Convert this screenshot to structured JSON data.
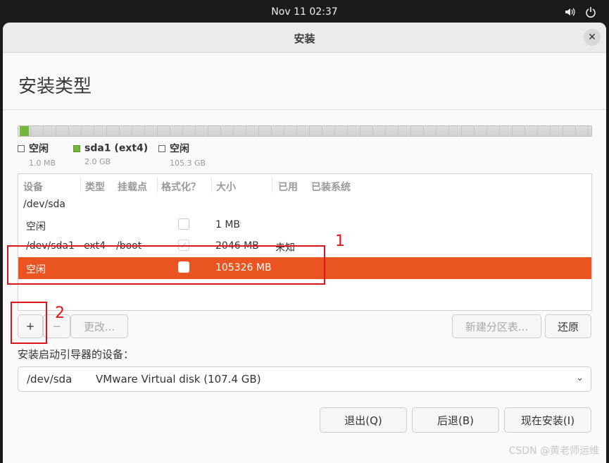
{
  "topbar": {
    "clock": "Nov 11  02:37"
  },
  "window": {
    "title": "安装",
    "close_label": "✕"
  },
  "page": {
    "heading": "安装类型"
  },
  "legend": [
    {
      "name": "空闲",
      "size": "1.0 MB"
    },
    {
      "name": "sda1 (ext4)",
      "size": "2.0 GB"
    },
    {
      "name": "空闲",
      "size": "105.3 GB"
    }
  ],
  "table": {
    "headers": [
      "设备",
      "类型",
      "挂载点",
      "格式化？",
      "大小",
      "已用",
      "已装系统"
    ],
    "rows": [
      {
        "device": "/dev/sda",
        "type": "",
        "mount": "",
        "format": null,
        "size": "",
        "used": ""
      },
      {
        "device": "空闲",
        "type": "",
        "mount": "",
        "format": "unchecked",
        "size": "1 MB",
        "used": ""
      },
      {
        "device": "/dev/sda1",
        "type": "ext4",
        "mount": "/boot",
        "format": "checked",
        "size": "2046 MB",
        "used": "未知"
      },
      {
        "device": "空闲",
        "type": "",
        "mount": "",
        "format": "unchecked",
        "size": "105326 MB",
        "used": "",
        "selected": true
      }
    ]
  },
  "toolbar": {
    "add": "+",
    "remove": "−",
    "change": "更改...",
    "new_table": "新建分区表...",
    "revert": "还原"
  },
  "bootloader": {
    "label": "安装启动引导器的设备：",
    "device": "/dev/sda",
    "description": "VMware Virtual disk (107.4 GB)"
  },
  "actions": {
    "quit": "退出(Q)",
    "back": "后退(B)",
    "install": "现在安装(I)"
  },
  "annotations": {
    "one": "1",
    "two": "2"
  },
  "watermark": "CSDN @黄老师运维",
  "colors": {
    "accent": "#e95420",
    "partition_green": "#74b83a",
    "annotation_red": "#e0141e"
  }
}
